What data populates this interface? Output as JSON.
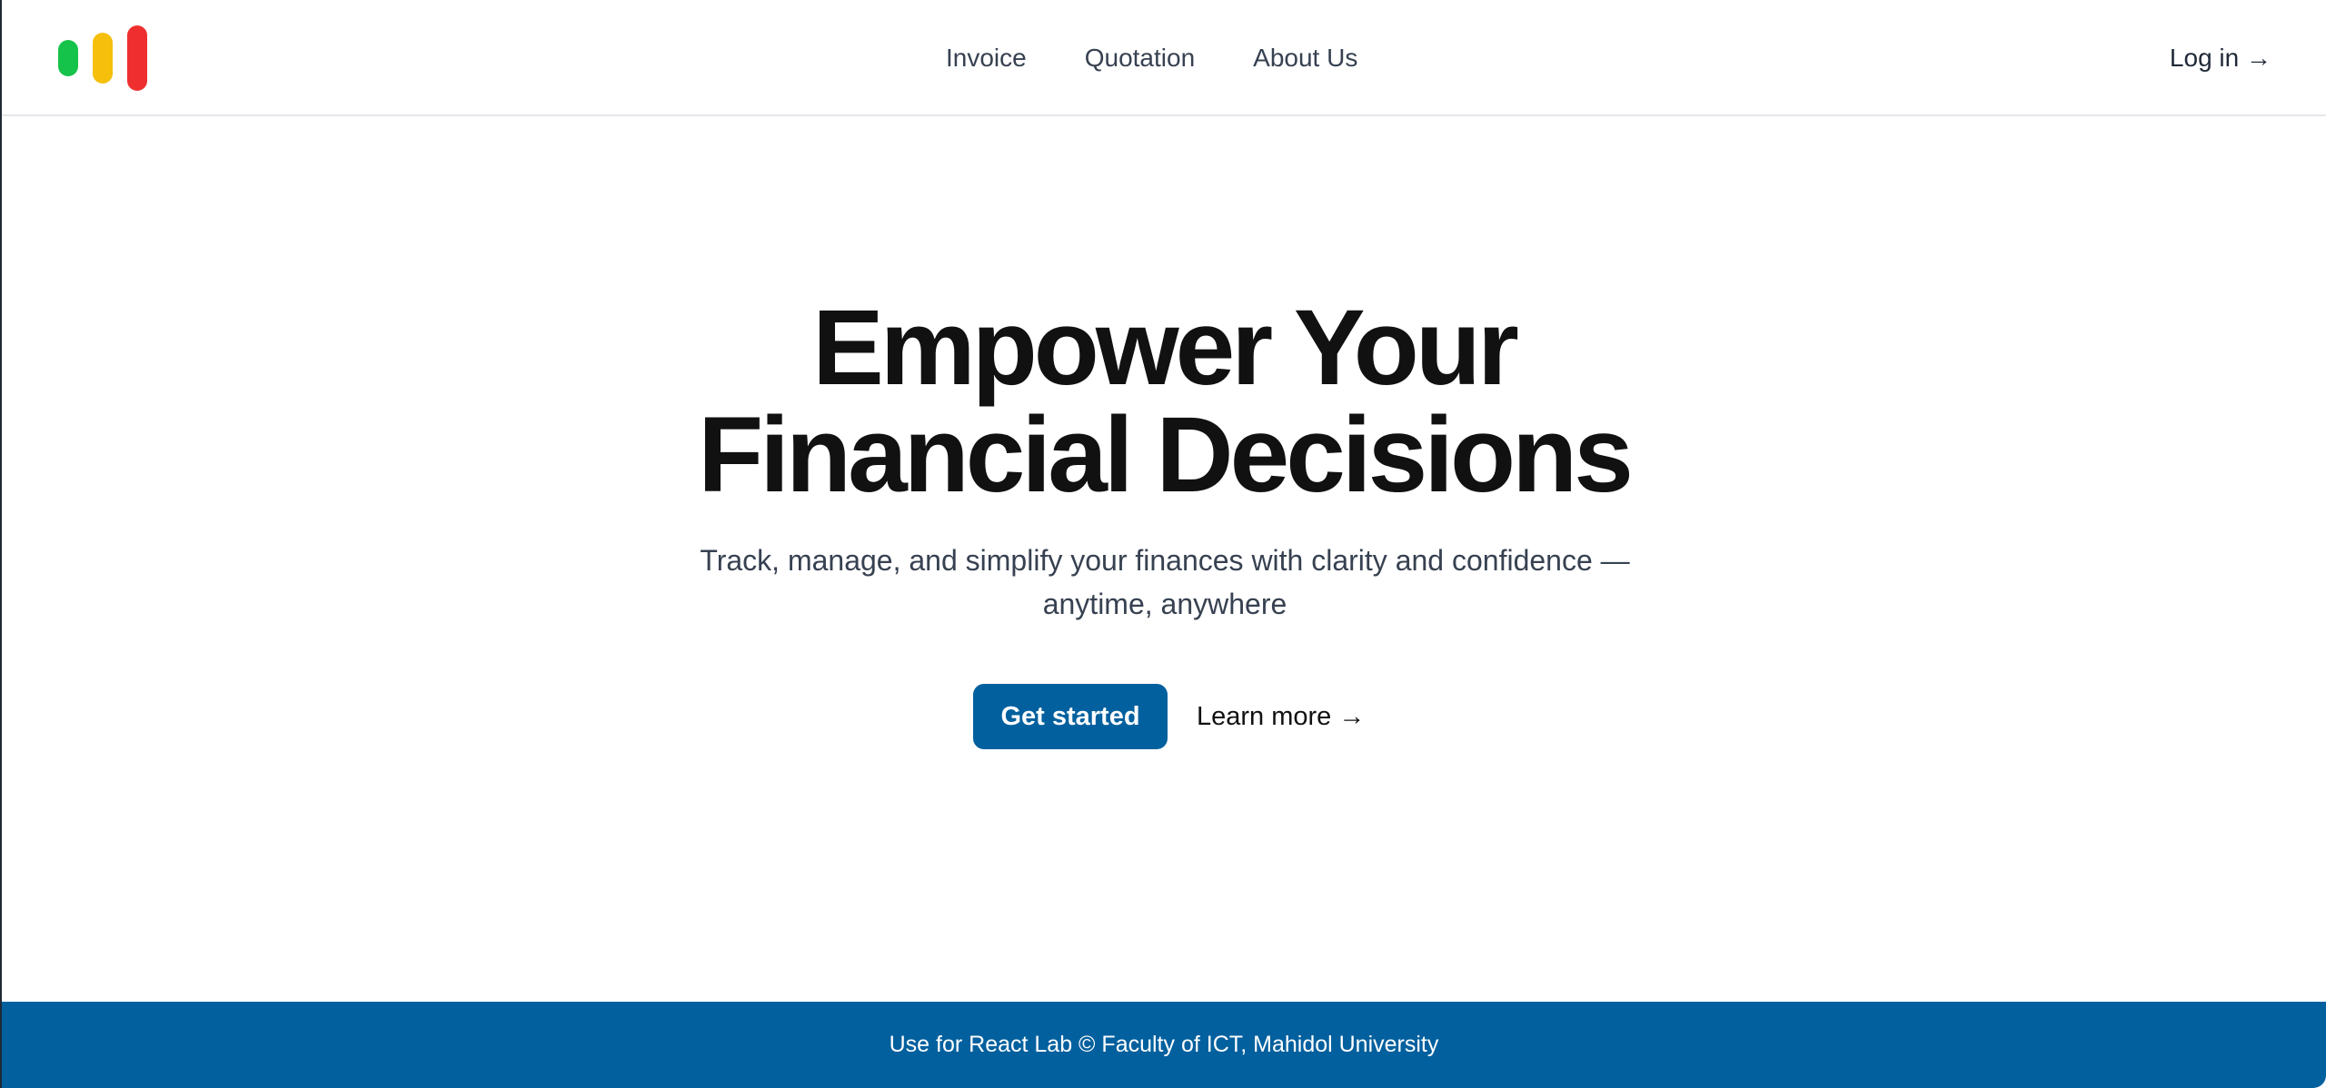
{
  "header": {
    "nav": {
      "invoice": "Invoice",
      "quotation": "Quotation",
      "about": "About Us"
    },
    "login_label": "Log in →"
  },
  "hero": {
    "title_line1": "Empower Your",
    "title_line2": "Financial Decisions",
    "subtitle_line1": "Track, manage, and simplify your finances with clarity and confidence —",
    "subtitle_line2": "anytime, anywhere",
    "primary_button": "Get started",
    "secondary_link": "Learn more →"
  },
  "footer": {
    "text": "Use for React Lab © Faculty of ICT, Mahidol University"
  },
  "colors": {
    "brand": "#02609e",
    "logo_green": "#16c34a",
    "logo_yellow": "#f5bf0b",
    "logo_red": "#ef2f2f"
  },
  "icons": {
    "logo": "three-bars-logo"
  }
}
